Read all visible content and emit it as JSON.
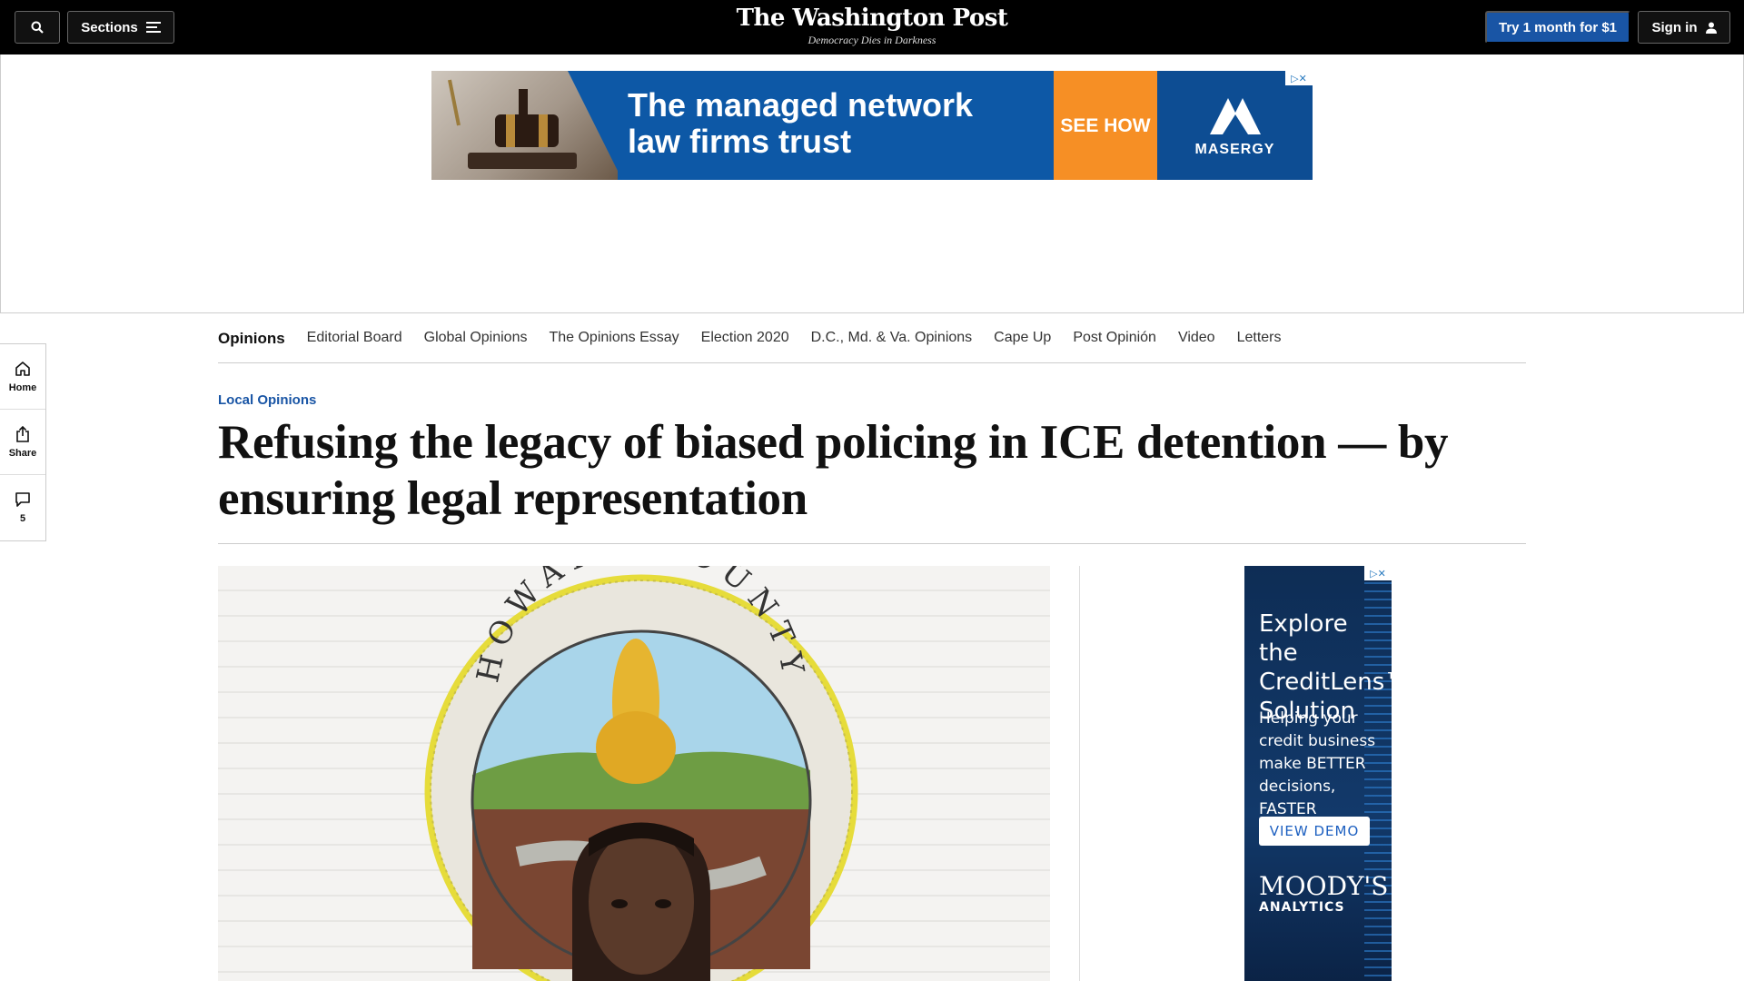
{
  "header": {
    "sections_label": "Sections",
    "logo_name": "The Washington Post",
    "logo_tagline": "Democracy Dies in Darkness",
    "subscribe_label": "Try 1 month for $1",
    "signin_label": "Sign in"
  },
  "top_ad": {
    "headline": "The managed network law firms trust",
    "cta": "SEE HOW",
    "brand": "MASERGY"
  },
  "opinions_nav": [
    "Opinions",
    "Editorial Board",
    "Global Opinions",
    "The Opinions Essay",
    "Election 2020",
    "D.C., Md. & Va. Opinions",
    "Cape Up",
    "Post Opinión",
    "Video",
    "Letters"
  ],
  "left_rail": {
    "home_label": "Home",
    "share_label": "Share",
    "comment_count": "5"
  },
  "article": {
    "kicker": "Local Opinions",
    "headline": "Refusing the legacy of biased policing in ICE detention — by ensuring legal representation",
    "seal_text": "HOWARD COUNTY"
  },
  "side_ad": {
    "headline": "Explore the CreditLens™ Solution",
    "subhead": "Helping your credit business make BETTER decisions, FASTER",
    "cta": "VIEW DEMO",
    "brand": "MOODY'S",
    "brand_sub": "ANALYTICS"
  },
  "icons": {
    "search": "search-icon",
    "sections": "hamburger-menu-icon",
    "signin": "user-icon",
    "home": "home-icon",
    "share": "share-icon",
    "comments": "comment-icon",
    "adchoices": "adchoices-icon"
  },
  "colors": {
    "header_bg": "#000000",
    "subscribe_button": "#1955a5",
    "kicker": "#1955a5",
    "ad_orange": "#f68f25"
  }
}
